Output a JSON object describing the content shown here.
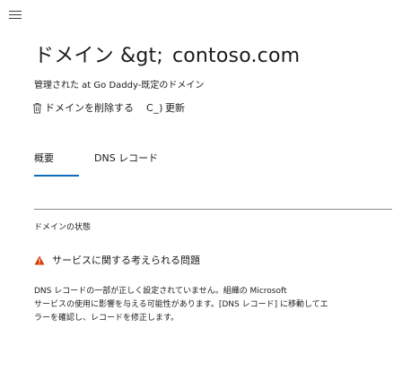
{
  "header": {
    "title_prefix": "ドメイン &gt;",
    "title_domain": "contoso.com",
    "subtitle": "管理された at Go Daddy-既定のドメイン"
  },
  "actions": {
    "delete_label": "ドメインを削除する",
    "refresh_glyph": "C_)",
    "refresh_label": "更新"
  },
  "tabs": [
    {
      "label": "概要",
      "active": true
    },
    {
      "label": "DNS レコード",
      "active": false
    }
  ],
  "status": {
    "section_label": "ドメインの状態",
    "warning_title": "サービスに関する考えられる問題",
    "message_lines": [
      "DNS レコードの一部が正しく設定されていません。組織の Microsoft",
      "サービスの使用に影響を与える可能性があります。[DNS レコード] に移動してエ",
      "ラーを確認し、レコードを修正します。"
    ]
  },
  "colors": {
    "accent": "#0f6cbd",
    "warning": "#d83b01",
    "text": "#1b1b1b",
    "divider": "#8a8a8a"
  },
  "icons": {
    "menu": "hamburger-menu-icon",
    "delete": "trash-icon",
    "warning": "warning-triangle-icon"
  }
}
